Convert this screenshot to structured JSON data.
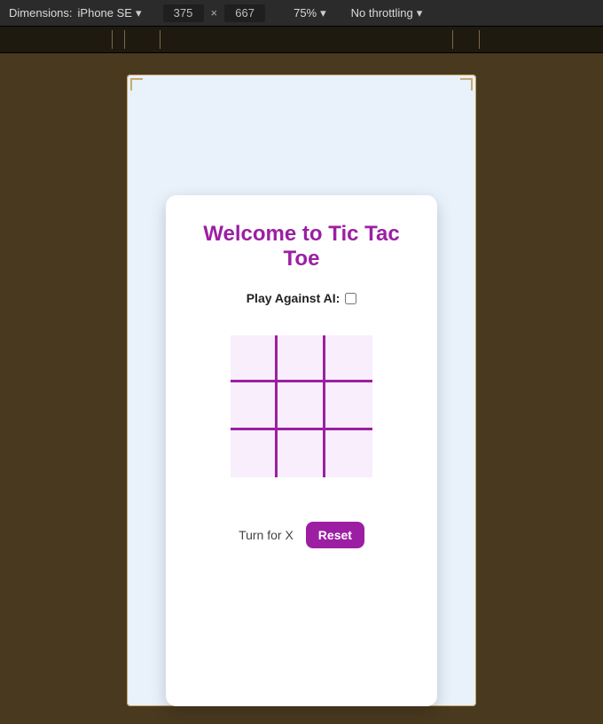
{
  "toolbar": {
    "dimensions_label": "Dimensions:",
    "device_name": "iPhone SE",
    "width": "375",
    "height": "667",
    "zoom": "75%",
    "throttling": "No throttling"
  },
  "game": {
    "title": "Welcome to Tic Tac Toe",
    "ai_label": "Play Against AI:",
    "ai_checked": false,
    "turn_text": "Turn for X",
    "reset_label": "Reset",
    "board": [
      "",
      "",
      "",
      "",
      "",
      "",
      "",
      "",
      ""
    ]
  },
  "colors": {
    "accent": "#9c1fa3",
    "cell_bg": "#f8eefc",
    "card_bg": "#ffffff",
    "device_bg": "#e9f1fb",
    "stage_bg": "#49391f"
  }
}
